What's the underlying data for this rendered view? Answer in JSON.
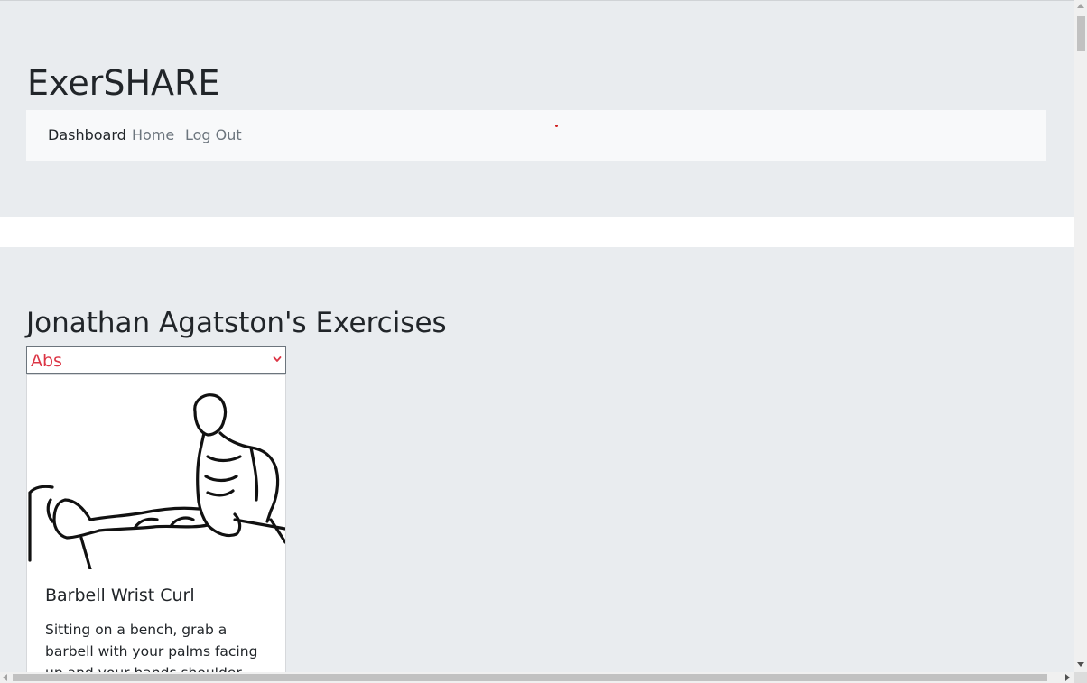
{
  "header": {
    "brand": "ExerSHARE",
    "nav": [
      {
        "label": "Dashboard",
        "active": true
      },
      {
        "label": "Home",
        "active": false
      },
      {
        "label": "Log Out",
        "active": false
      }
    ]
  },
  "main": {
    "heading": "Jonathan Agatston's Exercises",
    "category_select": {
      "value": "Abs",
      "color": "#dc3545"
    },
    "exercise_card": {
      "image": "tricep-dip-illustration",
      "title": "Barbell Wrist Curl",
      "description": "Sitting on a bench, grab a barbell with your palms facing up and your hands shoulder width apart"
    }
  },
  "colors": {
    "background": "#e9ecef",
    "navbar": "#f8f9fa",
    "text": "#212529",
    "muted_link": "#6c757d",
    "accent_red": "#dc3545"
  }
}
